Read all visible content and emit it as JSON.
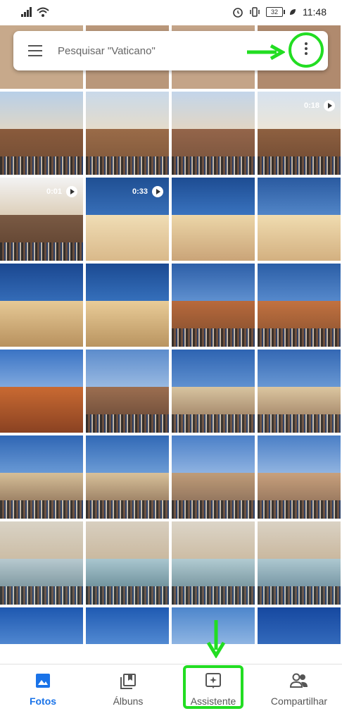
{
  "status_bar": {
    "battery": "32",
    "time": "11:48"
  },
  "search": {
    "placeholder": "Pesquisar \"Vaticano\""
  },
  "videos": {
    "v1": "0:18",
    "v2": "0:01",
    "v3": "0:33"
  },
  "nav": {
    "photos": "Fotos",
    "albums": "Álbuns",
    "assistant": "Assistente",
    "sharing": "Compartilhar"
  },
  "colors": {
    "accent": "#1a73e8",
    "highlight": "#22dd22"
  }
}
